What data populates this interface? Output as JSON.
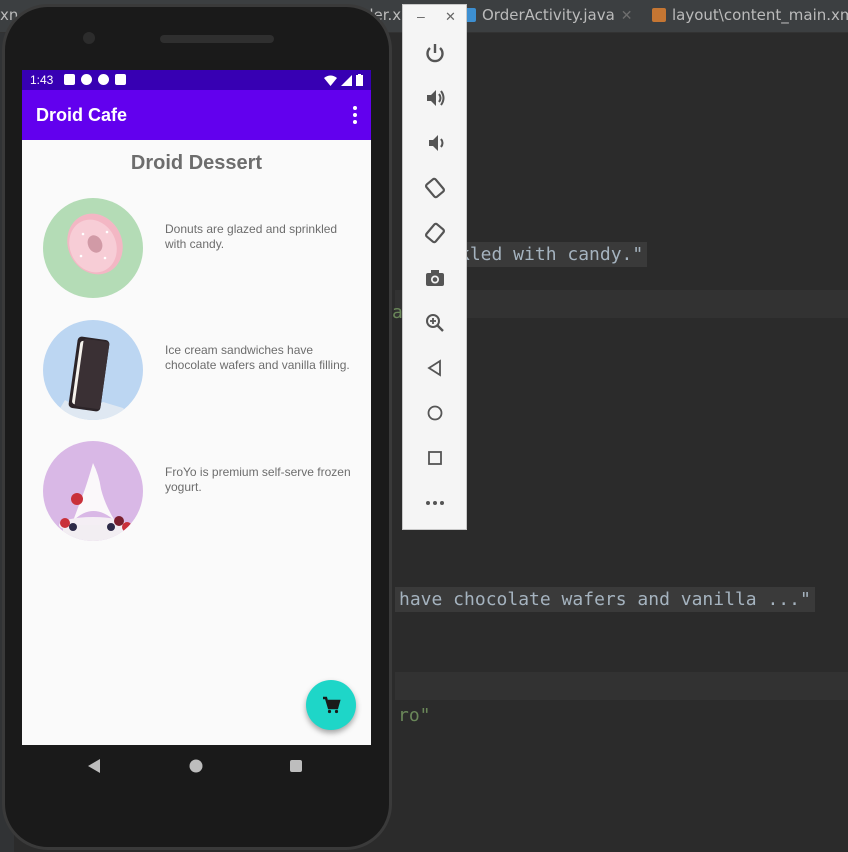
{
  "ide": {
    "tabs": [
      {
        "label": "xn",
        "icon": "xml-file-icon"
      },
      {
        "label": "der.x",
        "icon": "xml-file-icon"
      },
      {
        "label": "OrderActivity.java",
        "icon": "java-class-icon"
      },
      {
        "label": "layout\\content_main.xm",
        "icon": "layout-file-icon"
      }
    ],
    "code_lines": [
      "kled with candy.\"",
      "an",
      "have chocolate wafers and vanilla ...\"",
      "ro\""
    ]
  },
  "phone": {
    "status_bar": {
      "time": "1:43"
    },
    "app_bar": {
      "title": "Droid Cafe",
      "overflow_icon": "more-vert-icon"
    },
    "heading": "Droid Dessert",
    "items": [
      {
        "name": "donut",
        "image": "donut-image",
        "description": "Donuts are glazed and sprinkled with candy."
      },
      {
        "name": "ice-cream-sandwich",
        "image": "ice-cream-sandwich-image",
        "description": "Ice cream sandwiches have chocolate wafers and vanilla filling."
      },
      {
        "name": "froyo",
        "image": "froyo-image",
        "description": "FroYo is premium self-serve frozen yogurt."
      }
    ],
    "fab_icon": "shopping-cart-icon",
    "nav": [
      "back-icon",
      "home-icon",
      "recents-icon"
    ]
  },
  "emulator_toolbar": {
    "window_controls": [
      "minimize-icon",
      "close-icon"
    ],
    "buttons": [
      "power-icon",
      "volume-up-icon",
      "volume-down-icon",
      "rotate-left-icon",
      "rotate-right-icon",
      "camera-icon",
      "zoom-icon",
      "back-icon",
      "home-icon",
      "overview-icon",
      "more-icon"
    ]
  },
  "colors": {
    "primary": "#6200ee",
    "primary_dark": "#3700b3",
    "accent": "#1ed6c8",
    "ide_background": "#2b2b2b"
  }
}
